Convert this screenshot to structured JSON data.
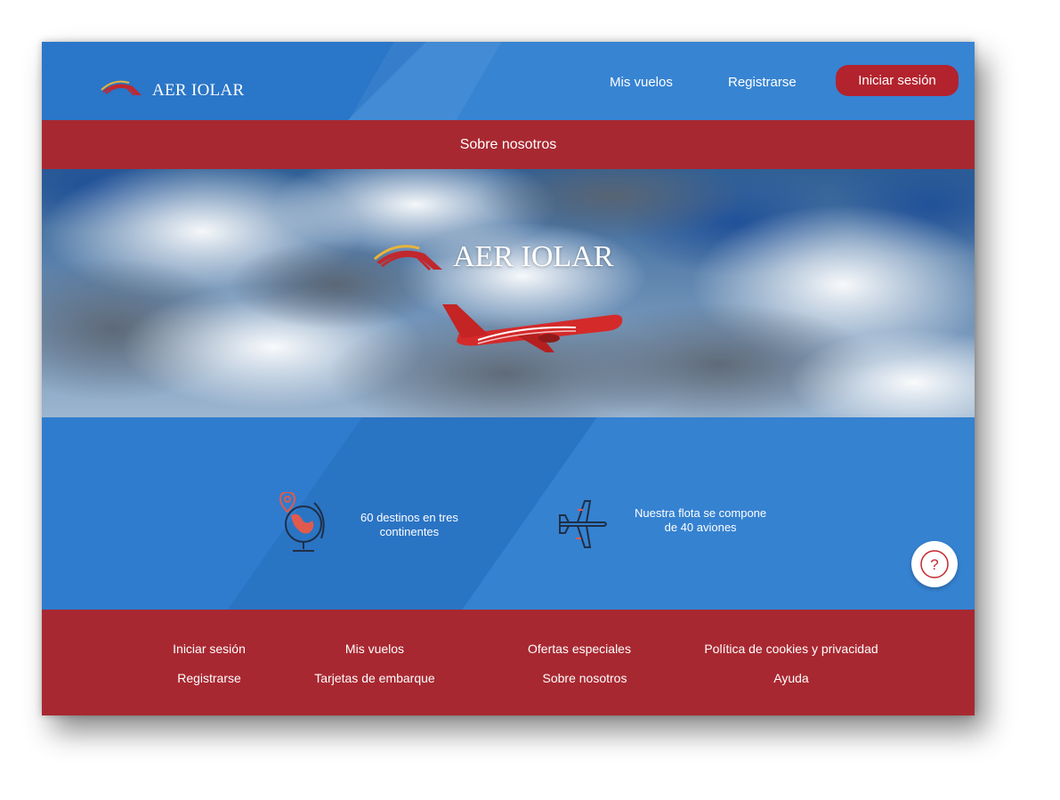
{
  "brand": {
    "name": "AER IOLAR",
    "colors": {
      "blue": "#2f7fcf",
      "red": "#a82831",
      "button_red": "#b3232d",
      "logo_red": "#c0282e",
      "logo_yellow": "#e8b43a"
    }
  },
  "header": {
    "logo_text": "AER IOLAR",
    "nav": {
      "my_flights": "Mis vuelos",
      "register": "Registrarse",
      "login": "Iniciar sesión"
    }
  },
  "about_bar": {
    "label": "Sobre nosotros"
  },
  "hero": {
    "logo_text": "AER IOLAR"
  },
  "stats": [
    {
      "icon": "globe-pin-icon",
      "line1": "60 destinos en tres",
      "line2": "continentes"
    },
    {
      "icon": "airplane-icon",
      "line1": "Nuestra flota se compone",
      "line2": "de 40 aviones"
    }
  ],
  "help": {
    "icon": "question-mark-icon",
    "glyph": "?"
  },
  "footer": {
    "col1": [
      "Iniciar sesión",
      "Registrarse"
    ],
    "col2": [
      "Mis vuelos",
      "Tarjetas de embarque"
    ],
    "col3": [
      "Ofertas especiales",
      "Sobre nosotros"
    ],
    "col4": [
      "Política de cookies y privacidad",
      "Ayuda"
    ]
  }
}
